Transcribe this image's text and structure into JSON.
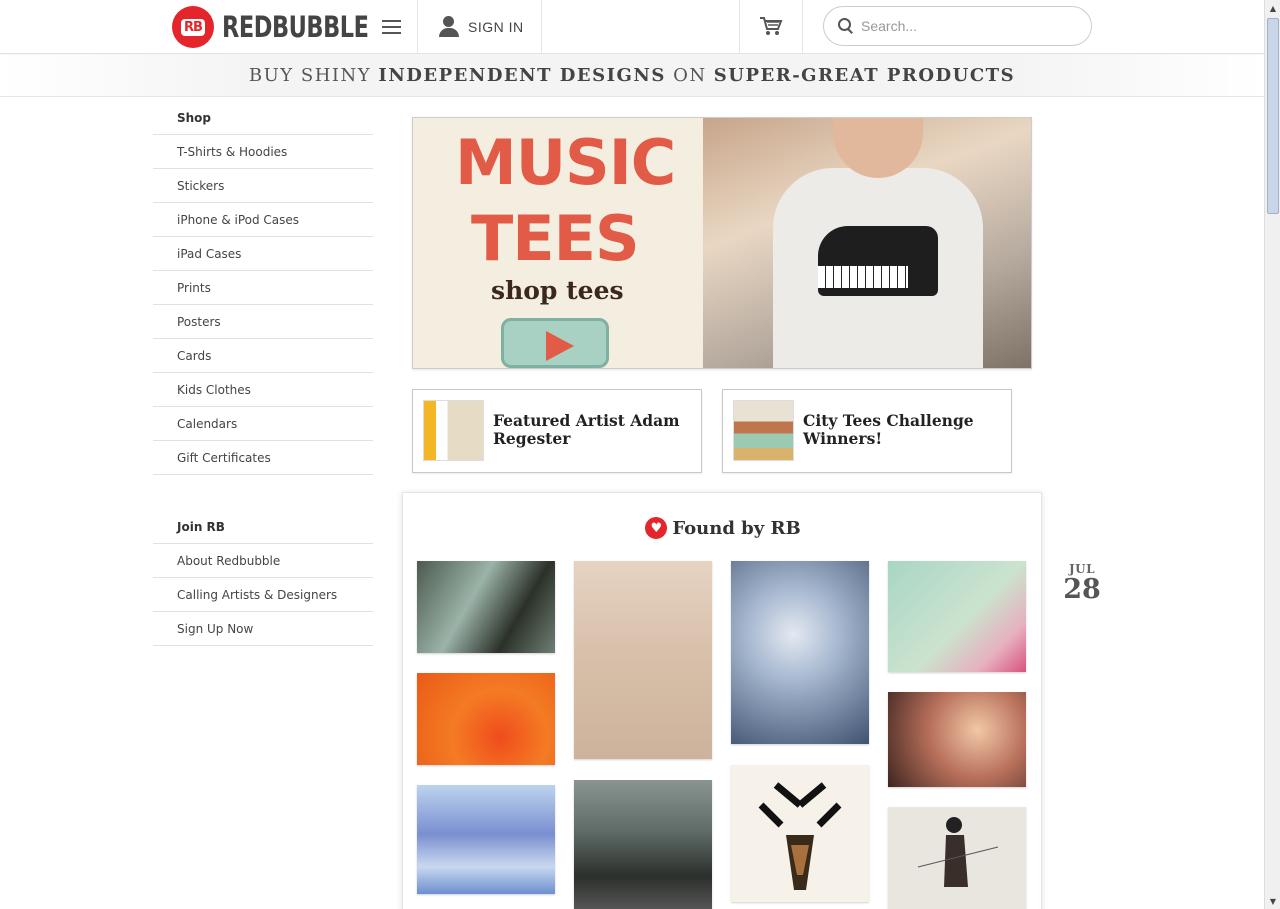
{
  "header": {
    "logo_badge": "RB",
    "logo_text": "REDBUBBLE",
    "signin_label": "SIGN IN",
    "search_placeholder": "Search..."
  },
  "tagline": {
    "part1": "BUY SHINY ",
    "bold1": "INDEPENDENT DESIGNS",
    "part2": " ON ",
    "bold2": "SUPER-GREAT PRODUCTS"
  },
  "sidebar": {
    "shop_heading": "Shop",
    "shop_items": [
      "T-Shirts & Hoodies",
      "Stickers",
      "iPhone & iPod Cases",
      "iPad Cases",
      "Prints",
      "Posters",
      "Cards",
      "Kids Clothes",
      "Calendars",
      "Gift Certificates"
    ],
    "join_heading": "Join RB",
    "join_items": [
      "About Redbubble",
      "Calling Artists & Designers",
      "Sign Up Now"
    ]
  },
  "hero": {
    "title_line1": "MUSIC",
    "title_line2": "TEES",
    "subtitle": "shop tees"
  },
  "features": [
    {
      "title": "Featured Artist Adam Regester"
    },
    {
      "title": "City Tees Challenge Winners!"
    }
  ],
  "found": {
    "title": "Found by RB"
  },
  "date": {
    "month": "JUL",
    "day": "28"
  },
  "colors": {
    "brand_red": "#e4262c",
    "hero_red": "#e25b47"
  }
}
